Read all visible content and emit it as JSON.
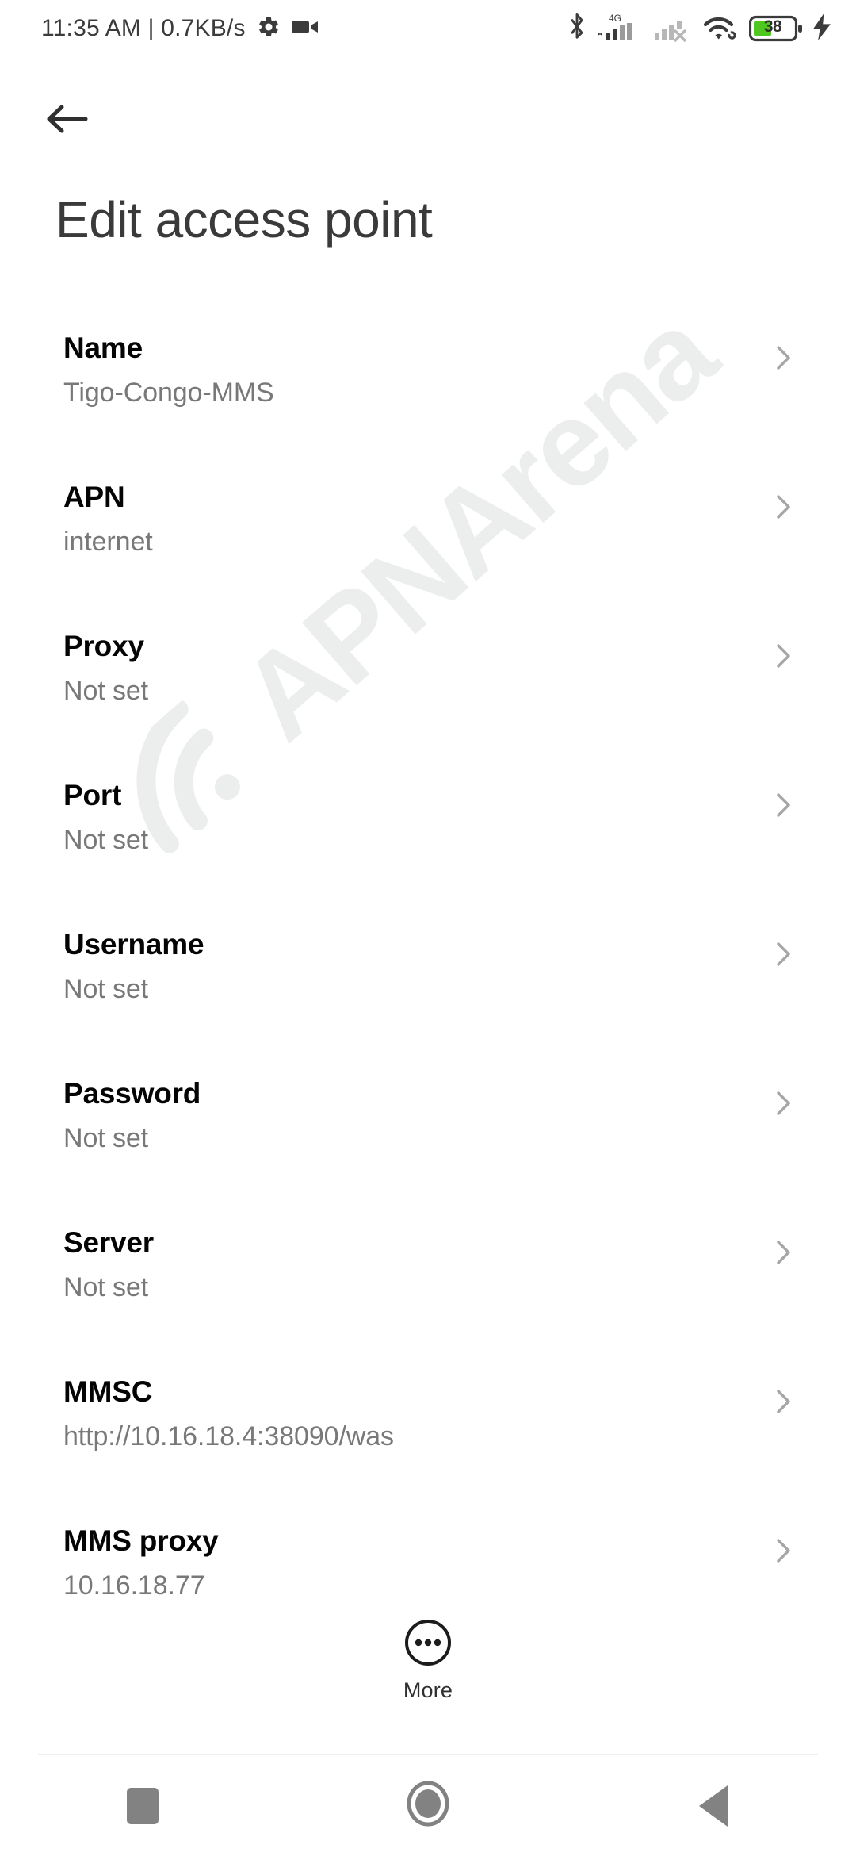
{
  "status_bar": {
    "time": "11:35 AM",
    "separator": "|",
    "network_speed": "0.7KB/s",
    "combined_text": "11:35 AM | 0.7KB/s",
    "icons": [
      "gear-icon",
      "video-camera-icon",
      "bluetooth-icon",
      "signal-4g-icon",
      "signal-no-service-icon",
      "wifi-icon",
      "battery-icon",
      "charging-bolt-icon"
    ],
    "network_type_label": "4G",
    "battery_percent": "38",
    "battery_fill_color": "#4ec81e",
    "charging": true
  },
  "header": {
    "back_icon": "arrow-left-icon",
    "title": "Edit access point"
  },
  "list": {
    "chevron_icon": "chevron-right-icon",
    "items": [
      {
        "title": "Name",
        "value": "Tigo-Congo-MMS"
      },
      {
        "title": "APN",
        "value": "internet"
      },
      {
        "title": "Proxy",
        "value": "Not set"
      },
      {
        "title": "Port",
        "value": "Not set"
      },
      {
        "title": "Username",
        "value": "Not set"
      },
      {
        "title": "Password",
        "value": "Not set"
      },
      {
        "title": "Server",
        "value": "Not set"
      },
      {
        "title": "MMSC",
        "value": "http://10.16.18.4:38090/was"
      },
      {
        "title": "MMS proxy",
        "value": "10.16.18.77"
      }
    ]
  },
  "more_button": {
    "icon": "more-dots-circle-icon",
    "label": "More"
  },
  "watermark": {
    "text": "APNArena",
    "icon": "wifi-signal-icon",
    "color": "#eceded"
  },
  "nav_bar": {
    "recents": "recents-square-icon",
    "home": "home-circle-icon",
    "back": "back-triangle-icon",
    "color": "#828282"
  },
  "colors": {
    "background": "#ffffff",
    "title_text": "#3a3a3a",
    "row_title": "#040404",
    "row_value": "#787878",
    "chevron": "#a6a6a6",
    "divider": "#eceff0"
  }
}
